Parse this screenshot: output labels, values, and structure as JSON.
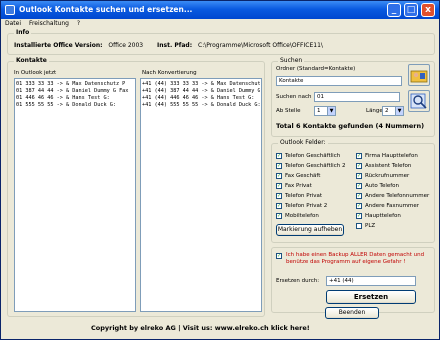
{
  "window": {
    "title": "Outlook Kontakte suchen und ersetzen...",
    "minimize": "_",
    "maximize": "□",
    "close": "x"
  },
  "menu": [
    "Datei",
    "Freischaltung",
    "?"
  ],
  "info": {
    "legend": "Info",
    "office_label": "Installierte Office Version:",
    "office_value": "Office 2003",
    "path_label": "Inst. Pfad:",
    "path_value": "C:\\Programme\\Microsoft Office\\OFFICE11\\"
  },
  "kontakte": {
    "legend": "Kontakte",
    "left_label": "In Outlook jetzt",
    "right_label": "Nach Konvertierung",
    "left_items": [
      "01 333 33 33 -> & Max Datenschutz P",
      "01 387 44 44 -> & Daniel Dummy G Fax",
      "01 446 46 46 -> & Hans Test G:",
      "01 555 55 55 -> & Donald Duck G:"
    ],
    "right_items": [
      "+41 (44) 333 33 33 -> & Max Datenschutz P",
      "+41 (44) 387 44 44 -> & Daniel Dummy G Fax",
      "+41 (44) 446 46 46 -> & Hans Test G:",
      "+41 (44) 555 55 55 -> & Donald Duck G:"
    ]
  },
  "suchen": {
    "legend": "Suchen",
    "ordner_label": "Ordner (Standard=Kontakte)",
    "ordner_value": "Kontakte",
    "suchen_nach_label": "Suchen nach",
    "suchen_nach_value": "01",
    "ab_stelle_label": "Ab Stelle",
    "ab_stelle_value": "1",
    "laenge_label": "Länge",
    "laenge_value": "2",
    "total": "Total 6 Kontakte gefunden (4 Nummern)"
  },
  "felder": {
    "legend": "Outlook Felder:",
    "left": [
      {
        "label": "Telefon Geschäftlich",
        "checked": true
      },
      {
        "label": "Telefon Geschäftlich 2",
        "checked": true
      },
      {
        "label": "Fax Geschäft",
        "checked": true
      },
      {
        "label": "Fax Privat",
        "checked": true
      },
      {
        "label": "Telefon Privat",
        "checked": true
      },
      {
        "label": "Telefon Privat 2",
        "checked": true
      },
      {
        "label": "Mobiltelefon",
        "checked": true
      }
    ],
    "right": [
      {
        "label": "Firma Haupttelefon",
        "checked": true
      },
      {
        "label": "Assistent Telefon",
        "checked": true
      },
      {
        "label": "Rückrufnummer",
        "checked": true
      },
      {
        "label": "Auto Telefon",
        "checked": true
      },
      {
        "label": "Andere Telefonnummer",
        "checked": true
      },
      {
        "label": "Andere Faxnummer",
        "checked": true
      },
      {
        "label": "Haupttelefon",
        "checked": true
      },
      {
        "label": "PLZ",
        "checked": false
      }
    ],
    "unmark_button": "Markierung aufheben"
  },
  "warn": {
    "text": "Ich habe einen Backup ALLER Daten gemacht und benütze das Programm auf eigene Gefahr !",
    "checked": true,
    "ersetzen_label": "Ersetzen durch:",
    "ersetzen_value": "+41 (44)",
    "ersetzen_button": "Ersetzen"
  },
  "footer": {
    "text": "Copyright by elreko AG | Visit us: www.elreko.ch    klick here!",
    "beenden_button": "Beenden"
  },
  "colors": {
    "title_bar": "#0a5ae0",
    "window_bg": "#ece9d8",
    "warning_text": "#c00000",
    "checkmark": "#21a121"
  }
}
